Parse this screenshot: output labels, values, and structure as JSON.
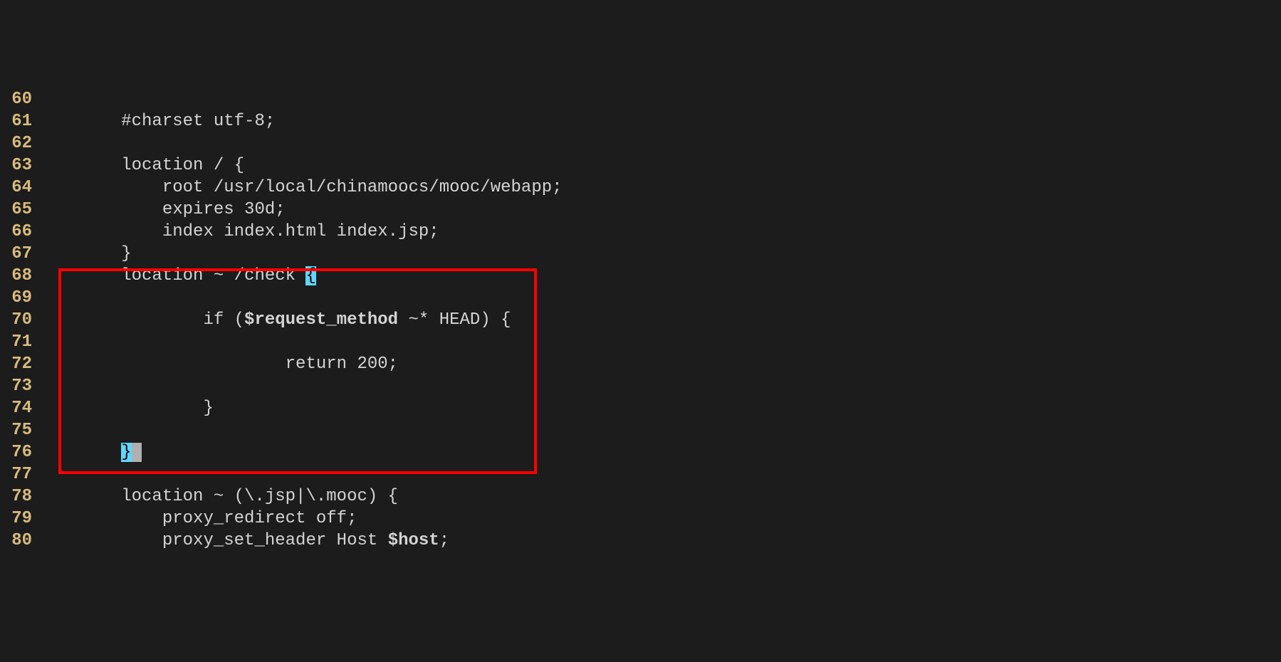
{
  "lines": [
    {
      "num": "60",
      "segments": [
        {
          "text": ""
        }
      ]
    },
    {
      "num": "61",
      "segments": [
        {
          "text": "        "
        },
        {
          "text": "#charset utf-8;",
          "cls": "c-white"
        }
      ]
    },
    {
      "num": "62",
      "segments": [
        {
          "text": ""
        }
      ]
    },
    {
      "num": "63",
      "segments": [
        {
          "text": "        "
        },
        {
          "text": "location / {",
          "cls": "c-white"
        }
      ]
    },
    {
      "num": "64",
      "segments": [
        {
          "text": "            "
        },
        {
          "text": "root /usr/local/chinamoocs/mooc/webapp;",
          "cls": "c-white"
        }
      ]
    },
    {
      "num": "65",
      "segments": [
        {
          "text": "            "
        },
        {
          "text": "expires 30d;",
          "cls": "c-white"
        }
      ]
    },
    {
      "num": "66",
      "segments": [
        {
          "text": "            "
        },
        {
          "text": "index index.html index.jsp;",
          "cls": "c-white"
        }
      ]
    },
    {
      "num": "67",
      "segments": [
        {
          "text": "        "
        },
        {
          "text": "}",
          "cls": "c-white"
        }
      ]
    },
    {
      "num": "68",
      "segments": [
        {
          "text": "        "
        },
        {
          "text": "location ~ /check ",
          "cls": "c-white"
        },
        {
          "text": "{",
          "cls": "cursor-brace"
        }
      ]
    },
    {
      "num": "69",
      "segments": [
        {
          "text": ""
        }
      ]
    },
    {
      "num": "70",
      "segments": [
        {
          "text": "                "
        },
        {
          "text": "if (",
          "cls": "c-white"
        },
        {
          "text": "$request_method",
          "cls": "c-var"
        },
        {
          "text": " ~* HEAD) {",
          "cls": "c-white"
        }
      ]
    },
    {
      "num": "71",
      "segments": [
        {
          "text": ""
        }
      ]
    },
    {
      "num": "72",
      "segments": [
        {
          "text": "                        "
        },
        {
          "text": "return 200;",
          "cls": "c-white"
        }
      ]
    },
    {
      "num": "73",
      "segments": [
        {
          "text": ""
        }
      ]
    },
    {
      "num": "74",
      "segments": [
        {
          "text": "                "
        },
        {
          "text": "}",
          "cls": "c-white"
        }
      ]
    },
    {
      "num": "75",
      "segments": [
        {
          "text": ""
        }
      ]
    },
    {
      "num": "76",
      "segments": [
        {
          "text": "        "
        },
        {
          "text": "}",
          "cls": "match-brace"
        },
        {
          "text": " ",
          "cls": "cursor-after"
        }
      ]
    },
    {
      "num": "77",
      "segments": [
        {
          "text": ""
        }
      ]
    },
    {
      "num": "78",
      "segments": [
        {
          "text": "        "
        },
        {
          "text": "location ~ (\\.jsp|\\.mooc) {",
          "cls": "c-white"
        }
      ]
    },
    {
      "num": "79",
      "segments": [
        {
          "text": "            "
        },
        {
          "text": "proxy_redirect off;",
          "cls": "c-white"
        }
      ]
    },
    {
      "num": "80",
      "segments": [
        {
          "text": "            "
        },
        {
          "text": "proxy_set_header Host ",
          "cls": "c-white"
        },
        {
          "text": "$host",
          "cls": "c-var"
        },
        {
          "text": ";",
          "cls": "c-white"
        }
      ]
    }
  ]
}
